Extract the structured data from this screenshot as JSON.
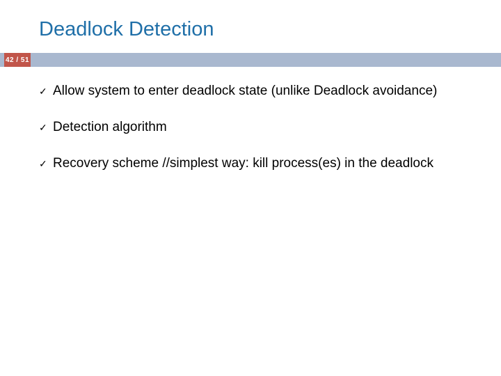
{
  "slide": {
    "title": "Deadlock Detection",
    "page_label": "42 / 51",
    "bullets": [
      {
        "text": "Allow system to enter deadlock state (unlike Deadlock avoidance)"
      },
      {
        "text": "Detection algorithm"
      },
      {
        "text": "Recovery scheme //simplest way: kill process(es) in the deadlock"
      }
    ],
    "check_glyph": "✓"
  }
}
